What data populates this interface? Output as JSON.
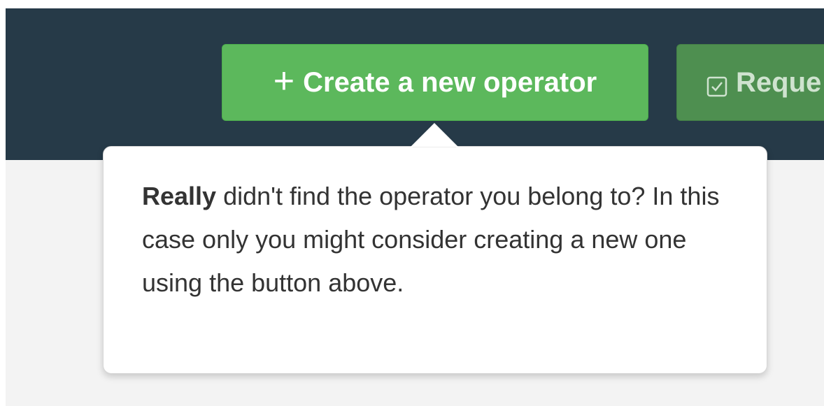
{
  "header": {
    "create_button": {
      "icon": "plus-icon",
      "icon_glyph": "+",
      "label": "Create a new operator"
    },
    "request_button": {
      "icon": "checkbox-icon",
      "label": "Reque"
    },
    "colors": {
      "header_bg": "#263a48",
      "create_green": "#5cb85c",
      "request_green": "#4e8f50"
    }
  },
  "popover": {
    "bold_lead": "Really",
    "text": " didn't find the operator you belong to? In this case only you might consider creating a new one using the button above."
  }
}
